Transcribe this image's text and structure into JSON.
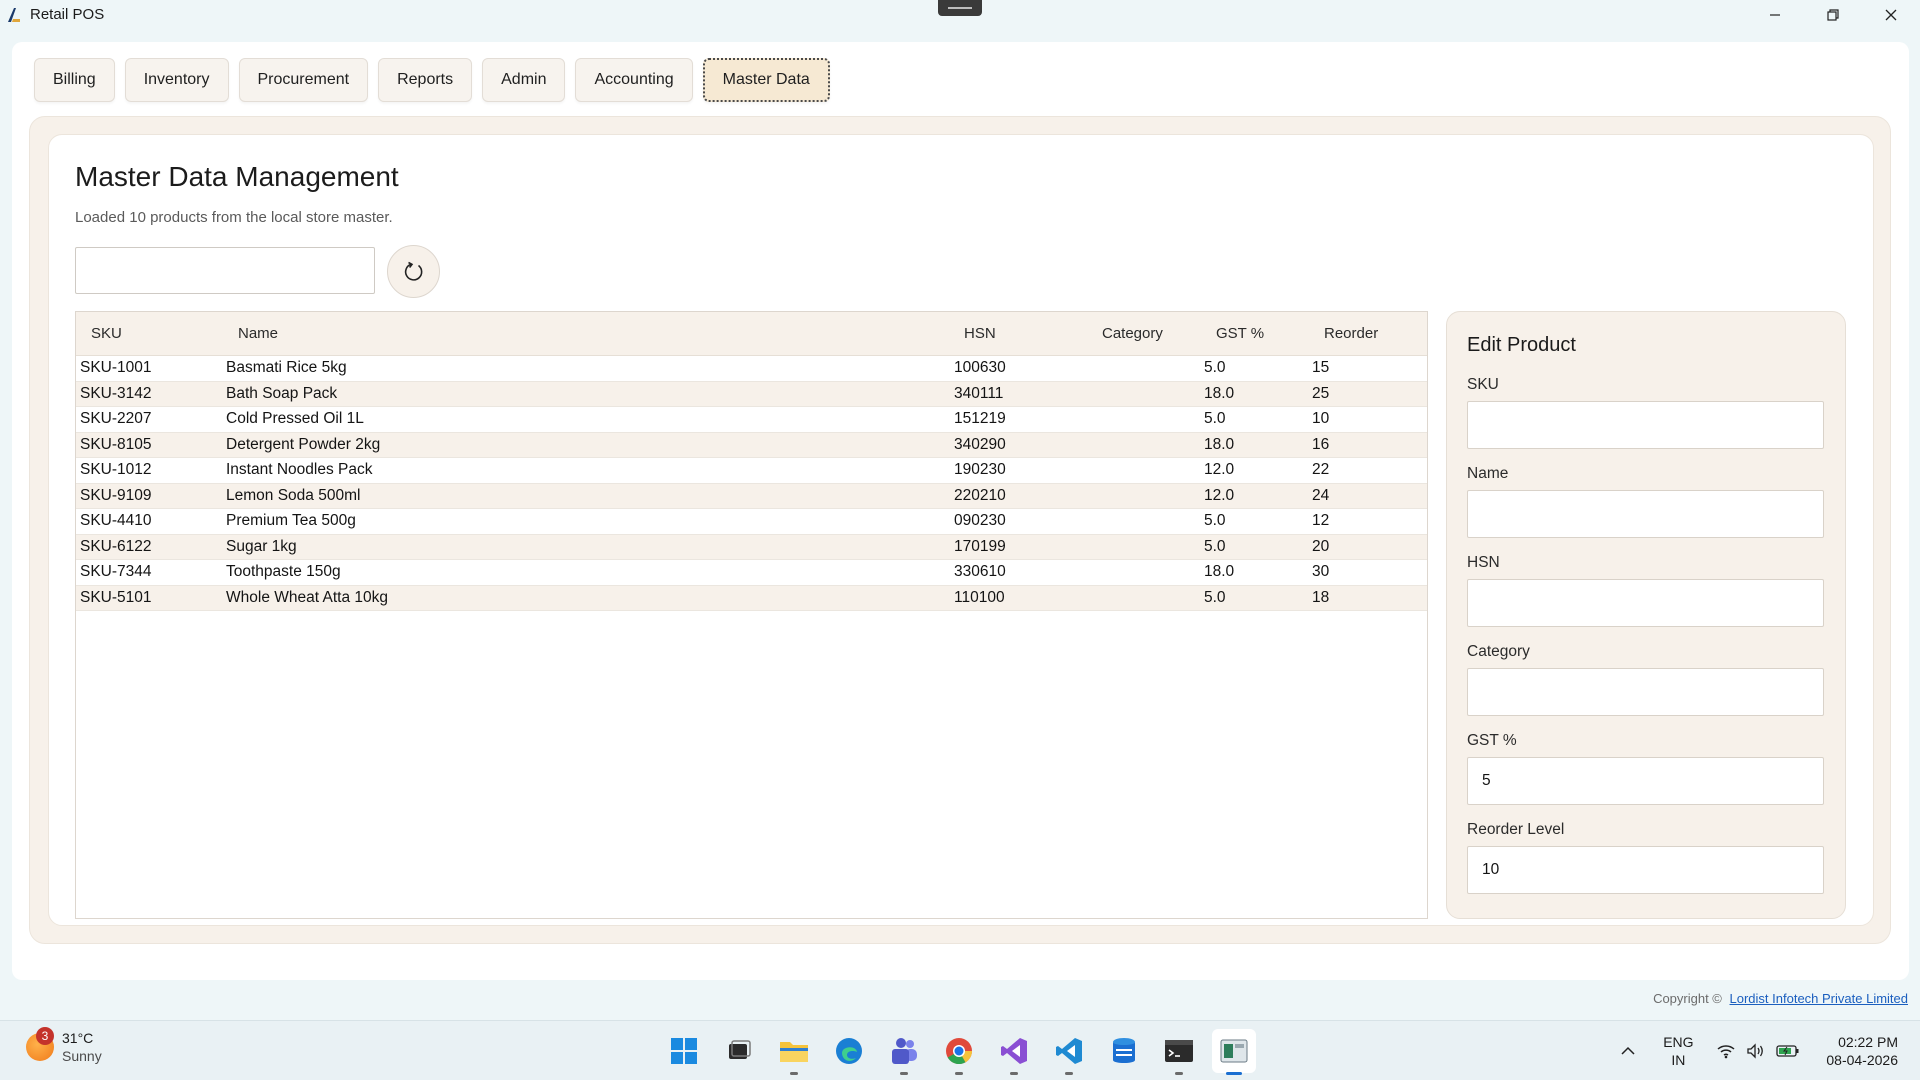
{
  "window": {
    "title": "Retail POS"
  },
  "tabs": [
    {
      "label": "Billing"
    },
    {
      "label": "Inventory"
    },
    {
      "label": "Procurement"
    },
    {
      "label": "Reports"
    },
    {
      "label": "Admin"
    },
    {
      "label": "Accounting"
    },
    {
      "label": "Master Data",
      "active": true
    }
  ],
  "page": {
    "title": "Master Data Management",
    "subtitle": "Loaded 10 products from the local store master.",
    "search_value": "",
    "refresh_icon": "refresh-icon"
  },
  "grid": {
    "columns": [
      "SKU",
      "Name",
      "HSN",
      "Category",
      "GST %",
      "Reorder"
    ],
    "rows": [
      {
        "sku": "SKU-1001",
        "name": "Basmati Rice 5kg",
        "hsn": "100630",
        "category": "",
        "gst": "5.0",
        "reorder": "15"
      },
      {
        "sku": "SKU-3142",
        "name": "Bath Soap Pack",
        "hsn": "340111",
        "category": "",
        "gst": "18.0",
        "reorder": "25"
      },
      {
        "sku": "SKU-2207",
        "name": "Cold Pressed Oil 1L",
        "hsn": "151219",
        "category": "",
        "gst": "5.0",
        "reorder": "10"
      },
      {
        "sku": "SKU-8105",
        "name": "Detergent Powder 2kg",
        "hsn": "340290",
        "category": "",
        "gst": "18.0",
        "reorder": "16"
      },
      {
        "sku": "SKU-1012",
        "name": "Instant Noodles Pack",
        "hsn": "190230",
        "category": "",
        "gst": "12.0",
        "reorder": "22"
      },
      {
        "sku": "SKU-9109",
        "name": "Lemon Soda 500ml",
        "hsn": "220210",
        "category": "",
        "gst": "12.0",
        "reorder": "24"
      },
      {
        "sku": "SKU-4410",
        "name": "Premium Tea 500g",
        "hsn": "090230",
        "category": "",
        "gst": "5.0",
        "reorder": "12"
      },
      {
        "sku": "SKU-6122",
        "name": "Sugar 1kg",
        "hsn": "170199",
        "category": "",
        "gst": "5.0",
        "reorder": "20"
      },
      {
        "sku": "SKU-7344",
        "name": "Toothpaste 150g",
        "hsn": "330610",
        "category": "",
        "gst": "18.0",
        "reorder": "30"
      },
      {
        "sku": "SKU-5101",
        "name": "Whole Wheat Atta 10kg",
        "hsn": "110100",
        "category": "",
        "gst": "5.0",
        "reorder": "18"
      }
    ]
  },
  "edit": {
    "title": "Edit Product",
    "fields": [
      {
        "label": "SKU",
        "value": ""
      },
      {
        "label": "Name",
        "value": ""
      },
      {
        "label": "HSN",
        "value": ""
      },
      {
        "label": "Category",
        "value": ""
      },
      {
        "label": "GST %",
        "value": "5"
      },
      {
        "label": "Reorder Level",
        "value": "10"
      }
    ]
  },
  "footer": {
    "copyright_prefix": "Copyright  ©",
    "company": "Lordist Infotech Private Limited"
  },
  "taskbar": {
    "weather_badge": "3",
    "temperature": "31°C",
    "condition": "Sunny",
    "apps": [
      "start-icon",
      "task-view-icon",
      "file-explorer-icon",
      "edge-icon",
      "teams-icon",
      "chrome-icon",
      "visual-studio-icon",
      "vscode-icon",
      "azure-data-studio-icon",
      "terminal-icon",
      "retail-pos-icon"
    ],
    "language_line1": "ENG",
    "language_line2": "IN",
    "time": "02:22 PM",
    "date": "08-04-2026"
  },
  "colors": {
    "panel_beige": "#f7f1ea",
    "active_tab": "#f6e9d3",
    "link_blue": "#1b5fbf",
    "taskbar_active": "#1b6fd1"
  }
}
